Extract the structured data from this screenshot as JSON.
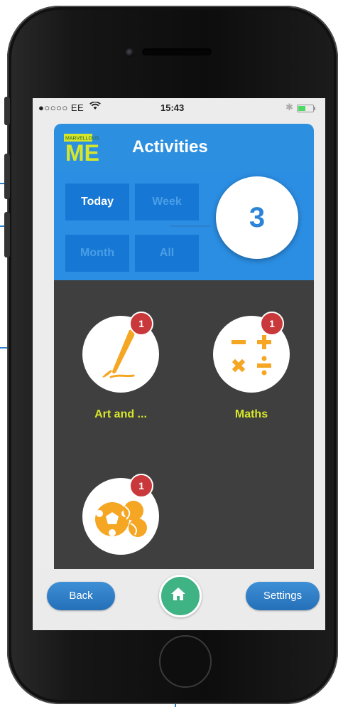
{
  "status_bar": {
    "carrier": "●○○○○ EE",
    "time": "15:43"
  },
  "header": {
    "logo_text": "MARVELLOUS",
    "logo_letters": "ME",
    "title": "Activities"
  },
  "filters": {
    "today": "Today",
    "week": "Week",
    "month": "Month",
    "all": "All",
    "selected": "Today",
    "count": "3"
  },
  "subjects": [
    {
      "label": "Art and ...",
      "badge": "1",
      "icon": "paintbrush-icon"
    },
    {
      "label": "Maths",
      "badge": "1",
      "icon": "math-operators-icon"
    },
    {
      "label": "",
      "badge": "1",
      "icon": "sports-balls-icon"
    }
  ],
  "bottom_bar": {
    "back": "Back",
    "settings": "Settings",
    "home_icon": "home-icon"
  },
  "colors": {
    "header_blue": "#2d8fe0",
    "filter_button": "#1677d4",
    "badge_red": "#c9383a",
    "label_yellow": "#d6e62a",
    "home_green": "#3fb384",
    "subject_orange": "#f5a623",
    "grid_bg": "#3f3f3f"
  }
}
